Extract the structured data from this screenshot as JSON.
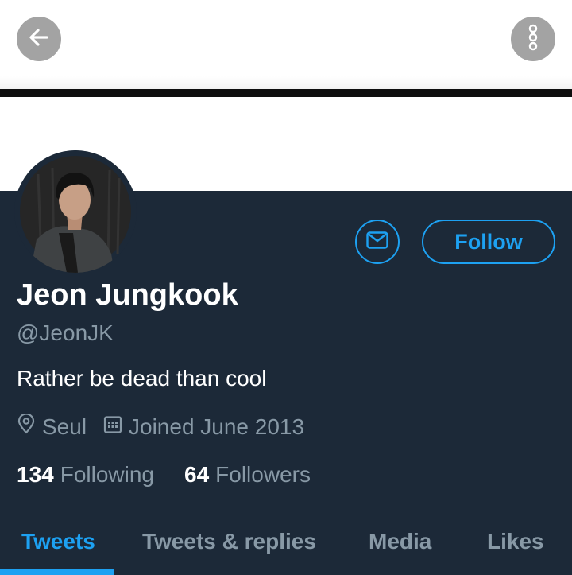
{
  "topbar": {
    "back_icon": "arrow-left-icon",
    "more_icon": "more-vertical-icon",
    "button_color": "#a3a3a3"
  },
  "profile": {
    "avatar_icon": "profile-photo",
    "message_icon": "envelope-icon",
    "follow_label": "Follow",
    "name": "Jeon Jungkook",
    "handle": "@JeonJK",
    "bio": "Rather be dead than cool",
    "location_icon": "location-pin-icon",
    "location": "Seul",
    "joined_icon": "calendar-icon",
    "joined": "Joined June 2013",
    "following_count": "134",
    "following_label": "Following",
    "followers_count": "64",
    "followers_label": "Followers"
  },
  "tabs": [
    {
      "label": "Tweets",
      "active": true
    },
    {
      "label": "Tweets & replies",
      "active": false
    },
    {
      "label": "Media",
      "active": false
    },
    {
      "label": "Likes",
      "active": false
    }
  ],
  "colors": {
    "background": "#1c2938",
    "accent": "#1da1f2",
    "secondary_text": "#8899a6",
    "primary_text": "#ffffff"
  }
}
